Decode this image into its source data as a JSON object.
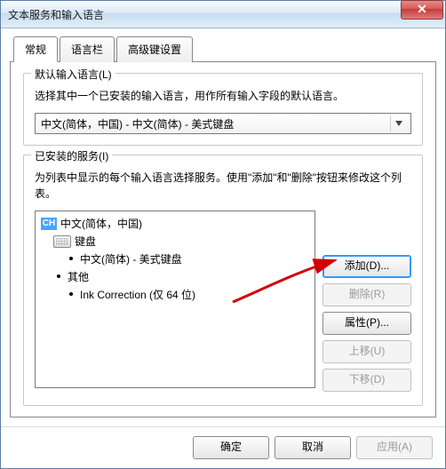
{
  "window": {
    "title": "文本服务和输入语言"
  },
  "tabs": [
    {
      "label": "常规"
    },
    {
      "label": "语言栏"
    },
    {
      "label": "高级键设置"
    }
  ],
  "default_lang": {
    "group_label": "默认输入语言(L)",
    "desc": "选择其中一个已安装的输入语言，用作所有输入字段的默认语言。",
    "selected": "中文(简体，中国) - 中文(简体) - 美式键盘"
  },
  "services": {
    "group_label": "已安装的服务(I)",
    "desc": "为列表中显示的每个输入语言选择服务。使用\"添加\"和\"删除\"按钮来修改这个列表。",
    "tree": {
      "lang_badge": "CH",
      "lang_label": "中文(简体，中国)",
      "keyboard_label": "键盘",
      "keyboard_item": "中文(简体) - 美式键盘",
      "other_label": "其他",
      "other_item": "Ink Correction (仅 64 位)"
    },
    "buttons": {
      "add": "添加(D)...",
      "remove": "删除(R)",
      "props": "属性(P)...",
      "up": "上移(U)",
      "down": "下移(D)"
    }
  },
  "footer": {
    "ok": "确定",
    "cancel": "取消",
    "apply": "应用(A)"
  }
}
